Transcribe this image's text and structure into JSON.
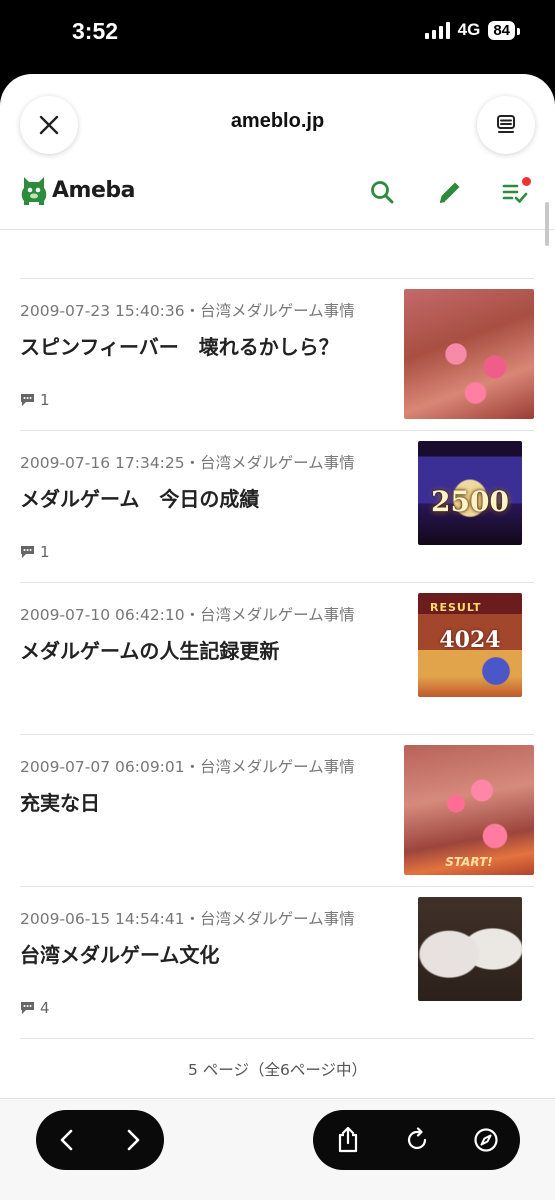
{
  "status_bar": {
    "time": "3:52",
    "network": "4G",
    "battery": "84"
  },
  "browser": {
    "domain": "ameblo.jp"
  },
  "site": {
    "logo_text": "Ameba"
  },
  "articles": [
    {
      "date": "2009-07-23 15:40:36",
      "category": "台湾メダルゲーム事情",
      "title": "スピンフィーバー　壊れるかしら？",
      "comments": "1"
    },
    {
      "date": "2009-07-16 17:34:25",
      "category": "台湾メダルゲーム事情",
      "title": "メダルゲーム　今日の成績",
      "comments": "1",
      "thumb_text": "2500"
    },
    {
      "date": "2009-07-10 06:42:10",
      "category": "台湾メダルゲーム事情",
      "title": "メダルゲームの人生記録更新",
      "thumb_text": "4024",
      "thumb_sub": "RESULT"
    },
    {
      "date": "2009-07-07 06:09:01",
      "category": "台湾メダルゲーム事情",
      "title": "充実な日",
      "thumb_sub": "START!"
    },
    {
      "date": "2009-06-15 14:54:41",
      "category": "台湾メダルゲーム事情",
      "title": "台湾メダルゲーム文化",
      "comments": "4"
    }
  ],
  "meta_separator": "・",
  "pagination": {
    "text": "5 ページ（全6ページ中）"
  },
  "colors": {
    "brand_green": "#2d8c3c",
    "notification_red": "#e33333",
    "meta_gray": "#777777"
  },
  "icons": [
    "close-icon",
    "tabs-icon",
    "search-icon",
    "pen-icon",
    "list-check-icon",
    "comment-icon",
    "back-arrow-icon",
    "forward-arrow-icon",
    "share-icon",
    "reload-icon",
    "compass-icon"
  ]
}
